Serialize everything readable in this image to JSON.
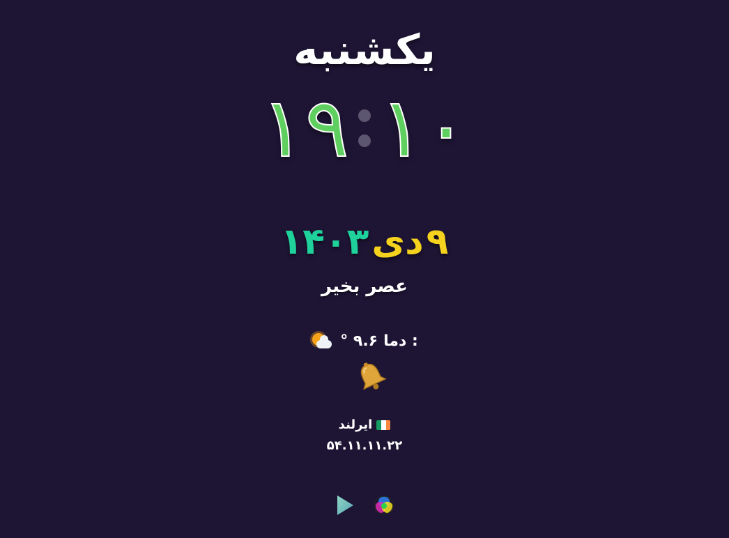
{
  "weekday": "یکشنبه",
  "clock": {
    "hours": "۱۹",
    "minutes": "۱۰"
  },
  "date": {
    "day": "۹",
    "month": "دی",
    "year": "۱۴۰۳"
  },
  "greeting": "عصر بخیر",
  "weather": {
    "label": "دما :",
    "temperature": "° ۹.۶",
    "icon": "sun-behind-cloud-icon"
  },
  "notification": {
    "icon": "bell-icon"
  },
  "location": {
    "country": "ایرلند",
    "flag": "ireland-flag-icon",
    "ip": "۵۴.۱۱.۱۱.۲۲"
  },
  "controls": {
    "play_icon": "play-icon",
    "color_icon": "color-wheel-icon"
  },
  "colors": {
    "background": "#1e1535",
    "clock": "#5fcf5f",
    "year": "#1fd19a",
    "day_month": "#f4d21e"
  }
}
